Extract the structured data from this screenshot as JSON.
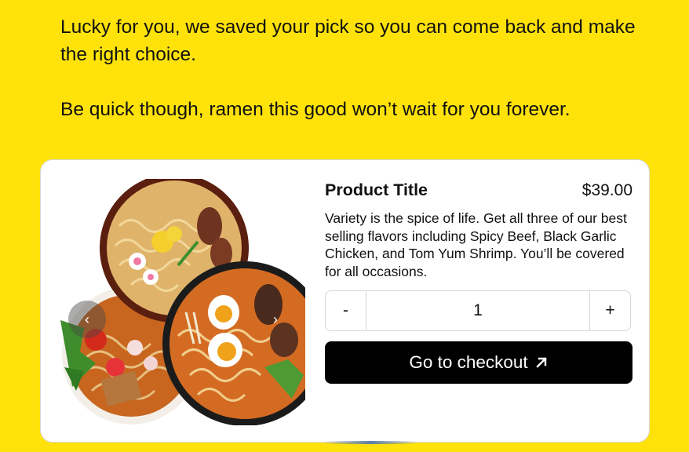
{
  "intro": {
    "line1": "Lucky for you, we saved your pick so you can come back and make the right choice.",
    "line2": "Be quick though, ramen this good won’t wait for you forever."
  },
  "product": {
    "title": "Product Title",
    "price": "$39.00",
    "description": "Variety is the spice of life. Get all three of our best selling flavors including Spicy Beef, Black Garlic Chicken, and Tom Yum Shrimp. You’ll be covered for all occasions."
  },
  "carousel": {
    "prev_icon": "‹",
    "next_icon": "›"
  },
  "quantity": {
    "decrement": "-",
    "value": "1",
    "increment": "+"
  },
  "checkout": {
    "label": "Go to checkout",
    "icon": "arrow-up-right-icon"
  },
  "colors": {
    "background": "#FFE20A",
    "button": "#000000"
  }
}
